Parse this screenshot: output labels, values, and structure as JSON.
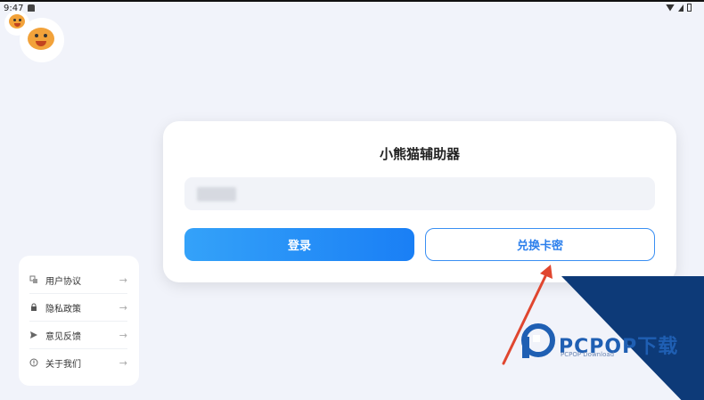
{
  "status_bar": {
    "time": "9:47"
  },
  "card": {
    "title": "小熊猫辅助器",
    "login_label": "登录",
    "redeem_label": "兑换卡密"
  },
  "menu": {
    "items": [
      {
        "label": "用户协议",
        "icon": "document-icon"
      },
      {
        "label": "隐私政策",
        "icon": "lock-icon"
      },
      {
        "label": "意见反馈",
        "icon": "send-icon"
      },
      {
        "label": "关于我们",
        "icon": "info-icon"
      }
    ],
    "arrow": "→"
  },
  "watermark": {
    "text": "PCPOP下载",
    "subtext": "PCPOP Download"
  },
  "colors": {
    "accent": "#1f87f5",
    "background": "#f1f3fa",
    "watermark": "#0d3a78"
  }
}
